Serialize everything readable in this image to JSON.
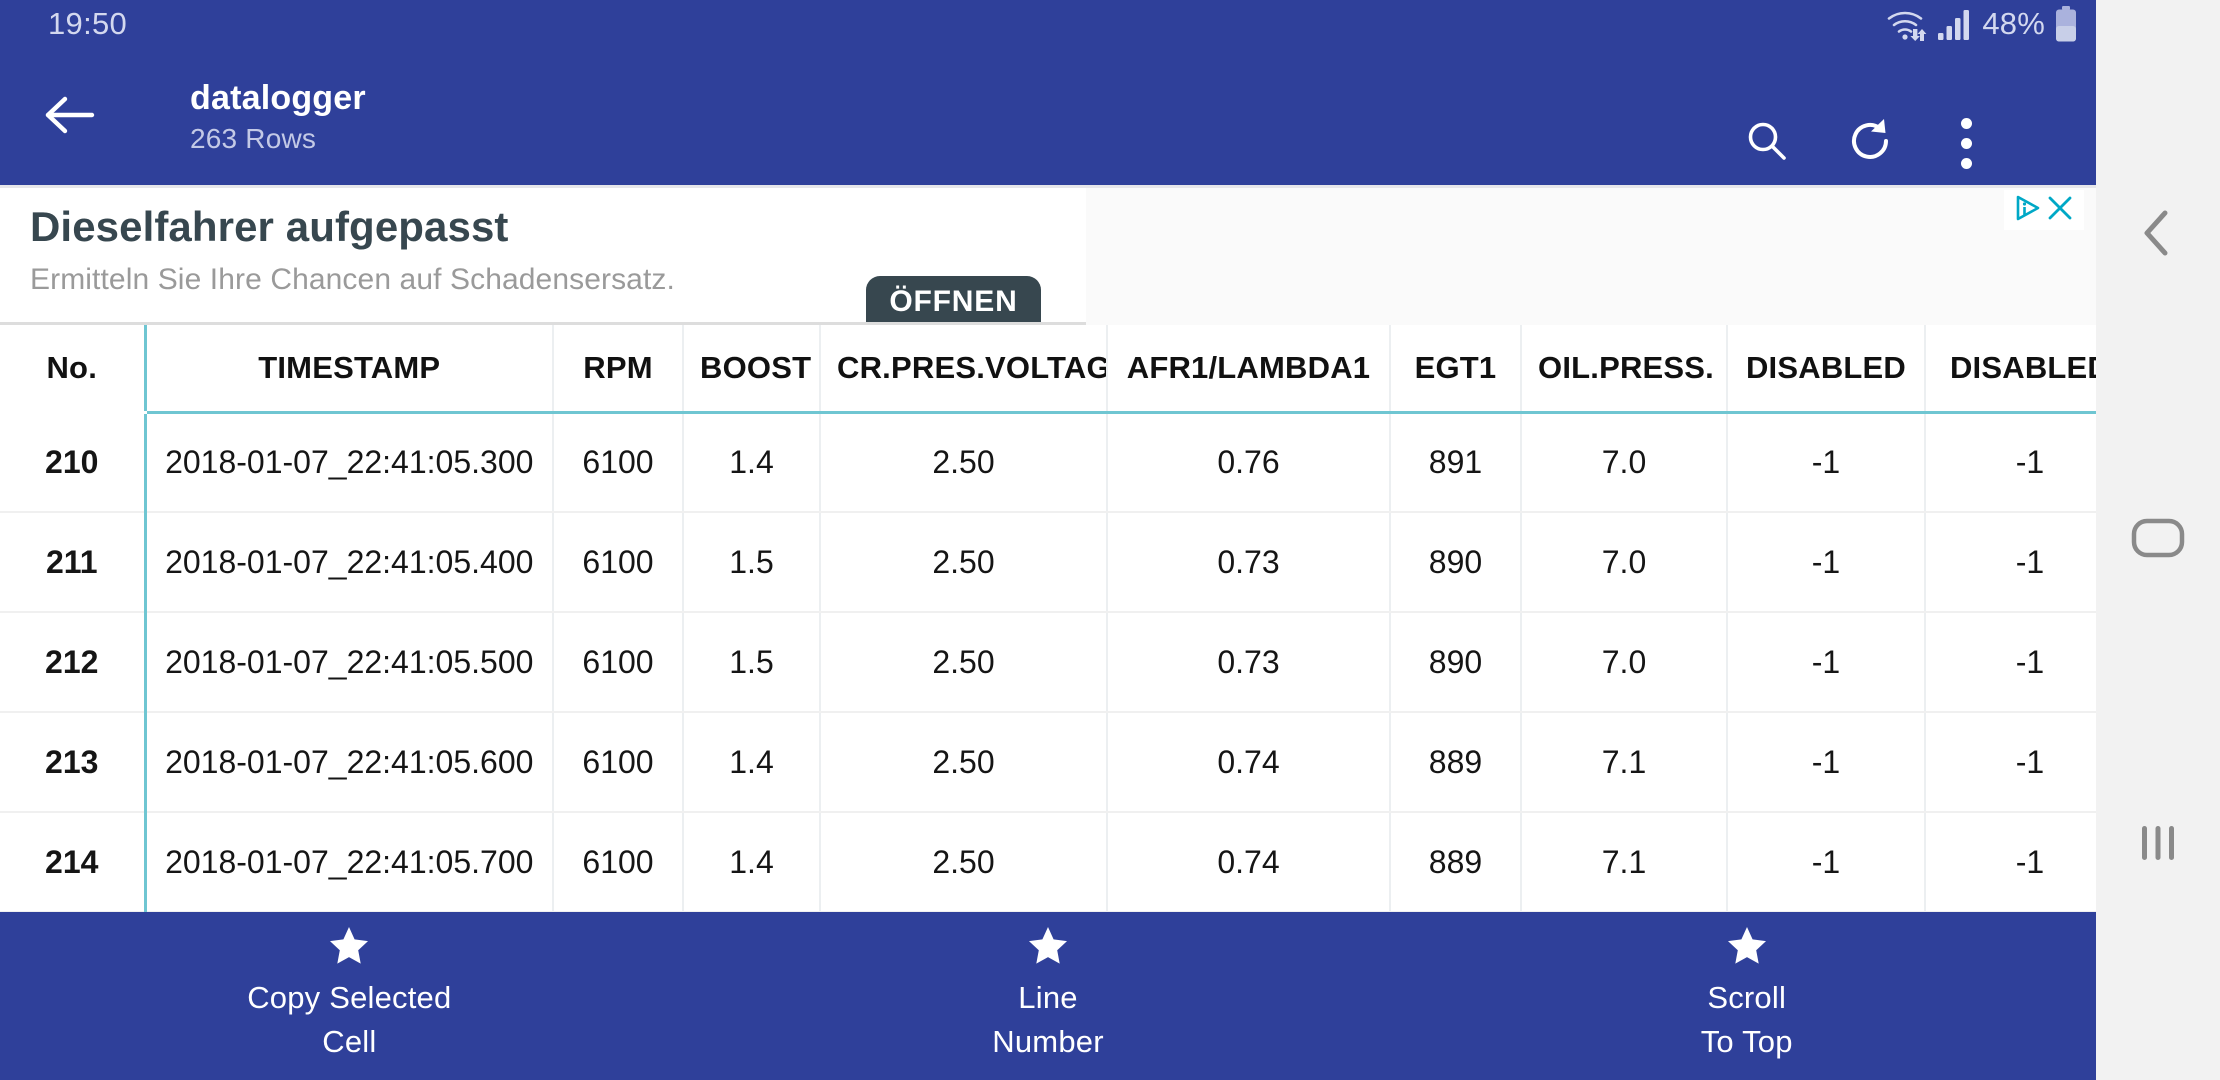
{
  "status_bar": {
    "clock": "19:50",
    "battery_percent": "48%",
    "wifi_icon": "wifi-updown-icon",
    "signal_icon": "cellular-signal-icon",
    "battery_icon": "battery-icon"
  },
  "app_bar": {
    "back_icon": "arrow-left-icon",
    "title": "datalogger",
    "subtitle": "263 Rows",
    "search_icon": "search-icon",
    "refresh_icon": "refresh-icon",
    "overflow_icon": "overflow-menu-icon"
  },
  "ad": {
    "headline": "Dieselfahrer aufgepasst",
    "subline": "Ermitteln Sie Ihre Chancen auf Schadensersatz.",
    "cta_label": "ÖFFNEN",
    "adchoices_icon": "adchoices-icon",
    "close_icon": "close-icon"
  },
  "table": {
    "columns": [
      "No.",
      "TIMESTAMP",
      "RPM",
      "BOOST",
      "CR.PRES.VOLTAGE",
      "AFR1/LAMBDA1",
      "EGT1",
      "OIL.PRESS.",
      "DISABLED",
      "DISABLED"
    ],
    "rows": [
      {
        "no": "210",
        "timestamp": "2018-01-07_22:41:05.300",
        "rpm": "6100",
        "boost": "1.4",
        "cr_pres_voltage": "2.50",
        "afr1_lambda1": "0.76",
        "egt1": "891",
        "oil_press": "7.0",
        "disabled1": "-1",
        "disabled2": "-1"
      },
      {
        "no": "211",
        "timestamp": "2018-01-07_22:41:05.400",
        "rpm": "6100",
        "boost": "1.5",
        "cr_pres_voltage": "2.50",
        "afr1_lambda1": "0.73",
        "egt1": "890",
        "oil_press": "7.0",
        "disabled1": "-1",
        "disabled2": "-1"
      },
      {
        "no": "212",
        "timestamp": "2018-01-07_22:41:05.500",
        "rpm": "6100",
        "boost": "1.5",
        "cr_pres_voltage": "2.50",
        "afr1_lambda1": "0.73",
        "egt1": "890",
        "oil_press": "7.0",
        "disabled1": "-1",
        "disabled2": "-1"
      },
      {
        "no": "213",
        "timestamp": "2018-01-07_22:41:05.600",
        "rpm": "6100",
        "boost": "1.4",
        "cr_pres_voltage": "2.50",
        "afr1_lambda1": "0.74",
        "egt1": "889",
        "oil_press": "7.1",
        "disabled1": "-1",
        "disabled2": "-1"
      },
      {
        "no": "214",
        "timestamp": "2018-01-07_22:41:05.700",
        "rpm": "6100",
        "boost": "1.4",
        "cr_pres_voltage": "2.50",
        "afr1_lambda1": "0.74",
        "egt1": "889",
        "oil_press": "7.1",
        "disabled1": "-1",
        "disabled2": "-1"
      }
    ]
  },
  "bottom_bar": {
    "items": [
      {
        "icon": "star-icon",
        "line1": "Copy Selected",
        "line2": "Cell"
      },
      {
        "icon": "star-icon",
        "line1": "Line",
        "line2": "Number"
      },
      {
        "icon": "star-icon",
        "line1": "Scroll",
        "line2": "To Top"
      }
    ]
  },
  "nav_bar": {
    "back_icon": "nav-back-icon",
    "home_icon": "nav-home-icon",
    "recents_icon": "nav-recents-icon"
  },
  "colors": {
    "app_bar": "#2f409a",
    "accent_teal": "#6fc6d2",
    "ad_cta": "#37474f",
    "adchoices": "#00a8c6"
  }
}
